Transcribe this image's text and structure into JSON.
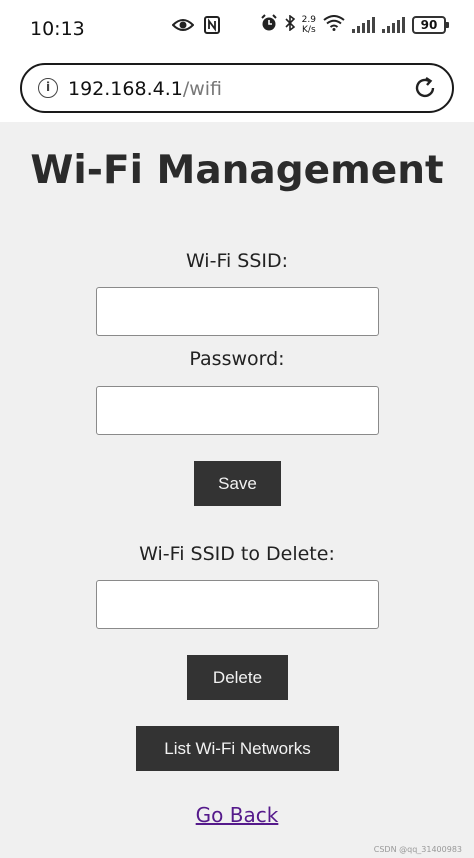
{
  "status_bar": {
    "time": "10:13",
    "speed_value": "2.9",
    "speed_unit": "K/s",
    "battery": "90"
  },
  "address_bar": {
    "host": "192.168.4.1",
    "path": "/wifi"
  },
  "page": {
    "title": "Wi-Fi Management",
    "ssid_label": "Wi-Fi SSID:",
    "ssid_value": "",
    "password_label": "Password:",
    "password_value": "",
    "save_button": "Save",
    "delete_label": "Wi-Fi SSID to Delete:",
    "delete_value": "",
    "delete_button": "Delete",
    "list_button": "List Wi-Fi Networks",
    "go_back_link": "Go Back"
  },
  "watermark": "CSDN @qq_31400983",
  "colors": {
    "page_bg": "#f0f0f0",
    "button_bg": "#333333",
    "link": "#551a8b"
  }
}
